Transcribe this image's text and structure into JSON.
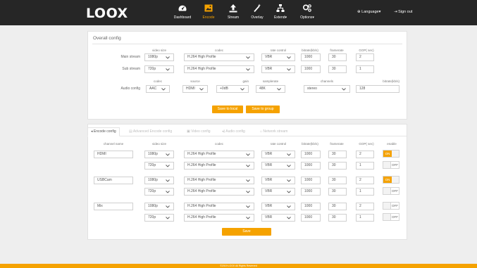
{
  "brand": {
    "logo": "LOOX",
    "accent": "#f5a200",
    "navbar_bg": "#262626"
  },
  "nav": {
    "items": [
      {
        "label": "Dashboard",
        "icon": "dashboard-icon"
      },
      {
        "label": "Encode",
        "icon": "image-icon",
        "active": true
      },
      {
        "label": "Stream",
        "icon": "upload-icon"
      },
      {
        "label": "Overlay",
        "icon": "wand-icon"
      },
      {
        "label": "Extend",
        "icon": "tree-icon"
      },
      {
        "label": "Options",
        "icon": "gears-icon"
      }
    ],
    "language": "Language",
    "signout": "Sign out"
  },
  "overall": {
    "title": "Overall config",
    "headers": {
      "video_size": "video size",
      "codec": "codec",
      "rate_control": "rate control",
      "bitrate": "bitrate(kb/s)",
      "framerate": "framerate",
      "gop": "GOP( sec)"
    },
    "main": {
      "label": "Main stream",
      "video_size": "1080p",
      "codec": "H.264 High Profile",
      "rate_control": "VBR",
      "bitrate": "1000",
      "framerate": "30",
      "gop": "2"
    },
    "sub": {
      "label": "Sub stream",
      "video_size": "720p",
      "codec": "H.264 High Profile",
      "rate_control": "VBR",
      "bitrate": "1000",
      "framerate": "30",
      "gop": "1"
    },
    "audio_headers": {
      "codec": "codec",
      "source": "source",
      "gain": "gain",
      "samplerate": "samplerate",
      "channels": "channels",
      "bitrate": "bitrate(kb/s)"
    },
    "audio": {
      "label": "Audio config",
      "codec": "AAC",
      "source": "HDMI",
      "gain": "+0dB",
      "samplerate": "48K",
      "channels": "stereo",
      "bitrate": "128"
    },
    "save_local": "Save to local",
    "save_group": "Save to group"
  },
  "tabs": [
    "Encode config",
    "Advanced Encode config",
    "Video config",
    "Audio config",
    "Network stream"
  ],
  "channels": {
    "headers": {
      "name": "channel name",
      "video_size": "video size",
      "codec": "codec",
      "rate_control": "rate control",
      "bitrate": "bitrate(kb/s)",
      "framerate": "framerate",
      "gop": "GOP( sec)",
      "enable": "enable"
    },
    "on_label": "ON",
    "off_label": "OFF",
    "list": [
      {
        "name": "HDMI",
        "main": {
          "video_size": "1080p",
          "codec": "H.264 High Profile",
          "rate_control": "VBR",
          "bitrate": "1000",
          "framerate": "30",
          "gop": "2",
          "enable": true
        },
        "sub": {
          "video_size": "720p",
          "codec": "H.264 High Profile",
          "rate_control": "VBR",
          "bitrate": "1000",
          "framerate": "30",
          "gop": "1",
          "enable": false
        }
      },
      {
        "name": "USBCam",
        "main": {
          "video_size": "1080p",
          "codec": "H.264 High Profile",
          "rate_control": "VBR",
          "bitrate": "1000",
          "framerate": "30",
          "gop": "2",
          "enable": true
        },
        "sub": {
          "video_size": "720p",
          "codec": "H.264 High Profile",
          "rate_control": "VBR",
          "bitrate": "1000",
          "framerate": "30",
          "gop": "1",
          "enable": false
        }
      },
      {
        "name": "Mix",
        "main": {
          "video_size": "1080p",
          "codec": "H.264 High Profile",
          "rate_control": "VBR",
          "bitrate": "1000",
          "framerate": "30",
          "gop": "2",
          "enable": false
        },
        "sub": {
          "video_size": "720p",
          "codec": "H.264 High Profile",
          "rate_control": "VBR",
          "bitrate": "1000",
          "framerate": "30",
          "gop": "1",
          "enable": false
        }
      }
    ],
    "save": "Save"
  },
  "footer": "©2019 LOOX  All Rights Reserved"
}
